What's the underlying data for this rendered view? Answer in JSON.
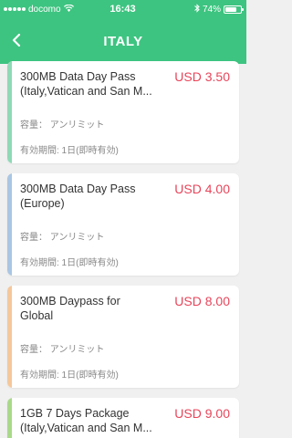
{
  "status_bar": {
    "carrier": "docomo",
    "time": "16:43",
    "battery_percent": "74%",
    "battery_level": 0.74
  },
  "nav": {
    "title": "ITALY"
  },
  "plans": [
    {
      "title_line1": "300MB Data Day Pass",
      "title_line2": "(Italy,Vatican and San M...",
      "price": "USD 3.50",
      "capacity": "容量： アンリミット",
      "validity": "有効期間: 1日(即時有効)",
      "accent": "#8fd9b6"
    },
    {
      "title_line1": "300MB Data Day Pass",
      "title_line2": "(Europe)",
      "price": "USD 4.00",
      "capacity": "容量： アンリミット",
      "validity": "有効期間: 1日(即時有効)",
      "accent": "#a9c6e3"
    },
    {
      "title_line1": "300MB Daypass for",
      "title_line2": "Global",
      "price": "USD 8.00",
      "capacity": "容量： アンリミット",
      "validity": "有効期間: 1日(即時有効)",
      "accent": "#f5c79a"
    },
    {
      "title_line1": "1GB 7 Days Package",
      "title_line2": "(Italy,Vatican and San M...",
      "price": "USD 9.00",
      "accent": "#a8d98a"
    }
  ],
  "colors": {
    "header": "#3dc480",
    "price": "#e8455a",
    "background": "#f0f0f0"
  }
}
